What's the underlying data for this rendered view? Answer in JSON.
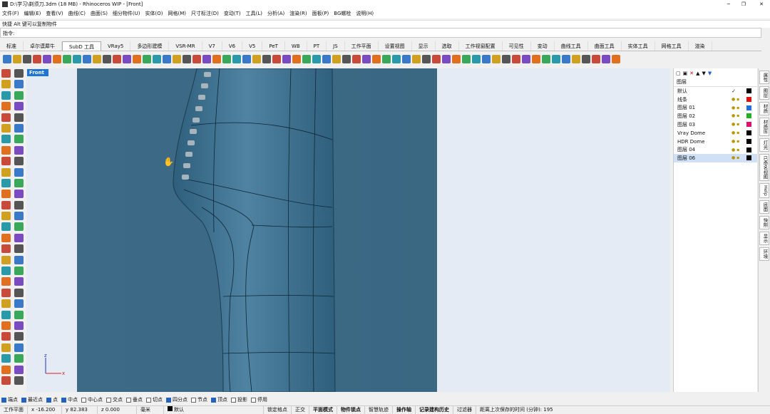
{
  "window": {
    "title": "D:\\学习\\剃须刀.3dm (18 MB) - Rhinoceros WIP - [Front]"
  },
  "menu": [
    "文件(F)",
    "编辑(E)",
    "查看(V)",
    "曲线(C)",
    "曲面(S)",
    "细分物件(U)",
    "实体(O)",
    "网格(M)",
    "尺寸标注(D)",
    "变动(T)",
    "工具(L)",
    "分析(A)",
    "渲染(R)",
    "面板(P)",
    "BG螺栓",
    "说明(H)"
  ],
  "command": {
    "history": "快捷 Alt 键可以复制物件",
    "prompt": "指令:"
  },
  "tabs": [
    "标准",
    "卓尔谟犀牛",
    "SubD 工具",
    "VRay5",
    "多边形建模",
    "VSR-MR",
    "V7",
    "V6",
    "V5",
    "PeT",
    "WB",
    "PT",
    "JS",
    "工作平面",
    "设置视图",
    "显示",
    "选取",
    "工作视窗配置",
    "可见性",
    "变动",
    "曲线工具",
    "曲面工具",
    "实体工具",
    "网格工具",
    "渲染"
  ],
  "viewport": {
    "label": "Front",
    "axis_x": "x",
    "axis_z": "z"
  },
  "layers": {
    "title": "图层",
    "rows": [
      {
        "name": "默认",
        "check": "✓",
        "color": "#000000"
      },
      {
        "name": "线条",
        "color": "#e01010"
      },
      {
        "name": "图层 01",
        "color": "#1f6fe0"
      },
      {
        "name": "图层 02",
        "color": "#22b022"
      },
      {
        "name": "图层 03",
        "color": "#e0106a"
      },
      {
        "name": "Vray Dome",
        "color": "#000000"
      },
      {
        "name": "HDR Dome",
        "color": "#000000"
      },
      {
        "name": "图层 04",
        "color": "#000000"
      },
      {
        "name": "图层 06",
        "color": "#000000"
      }
    ]
  },
  "right_tabs": [
    "属性",
    "图层",
    "材质",
    "材质库",
    "灯光",
    "已命名视图",
    "Help",
    "底面",
    "快照",
    "显示",
    "环境"
  ],
  "osnaps": [
    {
      "label": "端点",
      "on": true
    },
    {
      "label": "最近点",
      "on": true
    },
    {
      "label": "点",
      "on": true
    },
    {
      "label": "中点",
      "on": true
    },
    {
      "label": "中心点",
      "on": false
    },
    {
      "label": "交点",
      "on": false
    },
    {
      "label": "垂点",
      "on": false
    },
    {
      "label": "切点",
      "on": false
    },
    {
      "label": "四分点",
      "on": true
    },
    {
      "label": "节点",
      "on": false
    },
    {
      "label": "顶点",
      "on": true
    },
    {
      "label": "投影",
      "on": false
    },
    {
      "label": "停用",
      "on": false
    }
  ],
  "status": {
    "cplane": "工作平面",
    "x": "x -16.200",
    "y": "y 82.383",
    "z": "z 0.000",
    "units": "毫米",
    "layer": "默认",
    "items": [
      "锁定格点",
      "正交",
      "平面模式",
      "物件锁点",
      "智慧轨迹",
      "操作轴",
      "记录建构历史",
      "过滤器"
    ],
    "bold_items": [
      false,
      false,
      true,
      true,
      false,
      true,
      true,
      false
    ],
    "autosave": "距离上次保存的时间 (分钟): 195"
  }
}
